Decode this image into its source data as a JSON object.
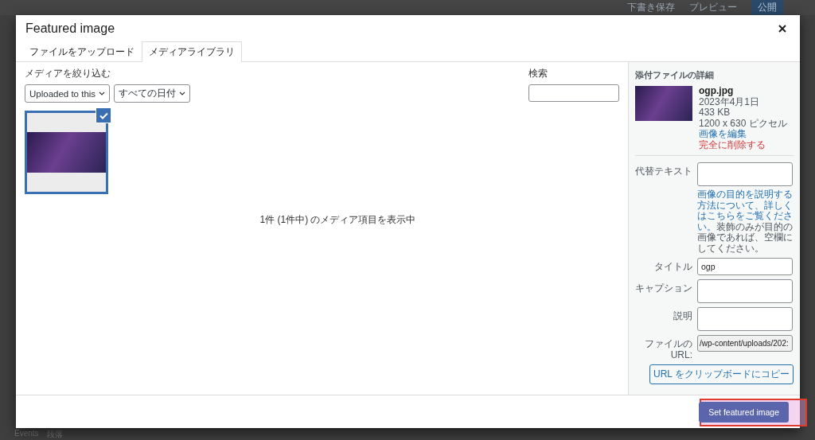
{
  "background": {
    "actions": [
      "下書き保存",
      "プレビュー",
      "公開"
    ],
    "breadcrumb": [
      "Events",
      "段落"
    ]
  },
  "modal": {
    "title": "Featured image",
    "tabs": [
      {
        "label": "ファイルをアップロード",
        "selected": false
      },
      {
        "label": "メディアライブラリ",
        "selected": true
      }
    ],
    "filter": {
      "label": "メディアを絞り込む",
      "type_select": "Uploaded to this",
      "date_select": "すべての日付"
    },
    "search": {
      "label": "検索"
    },
    "media": [
      {
        "selected": true
      }
    ],
    "count_text": "1件 (1件中) のメディア項目を表示中",
    "details": {
      "heading": "添付ファイルの詳細",
      "filename": "ogp.jpg",
      "date": "2023年4月1日",
      "size": "433 KB",
      "dimensions": "1200 x 630 ピクセル",
      "edit_link": "画像を編集",
      "delete_link": "完全に削除する",
      "fields": [
        {
          "kind": "textarea",
          "label": "代替テキスト",
          "help_link": "画像の目的を説明する方法について、詳しくはこちらをご覧ください。",
          "help_text": "装飾のみが目的の画像であれば、空欄にしてください。"
        },
        {
          "kind": "input",
          "label": "タイトル",
          "value": "ogp"
        },
        {
          "kind": "textarea",
          "label": "キャプション"
        },
        {
          "kind": "textarea",
          "label": "説明"
        },
        {
          "kind": "readonly",
          "label": "ファイルの URL:",
          "value": "/wp-content/uploads/202:"
        },
        {
          "kind": "button",
          "label": "URL をクリップボードにコピー"
        }
      ]
    },
    "footer_button": "Set featured image"
  }
}
